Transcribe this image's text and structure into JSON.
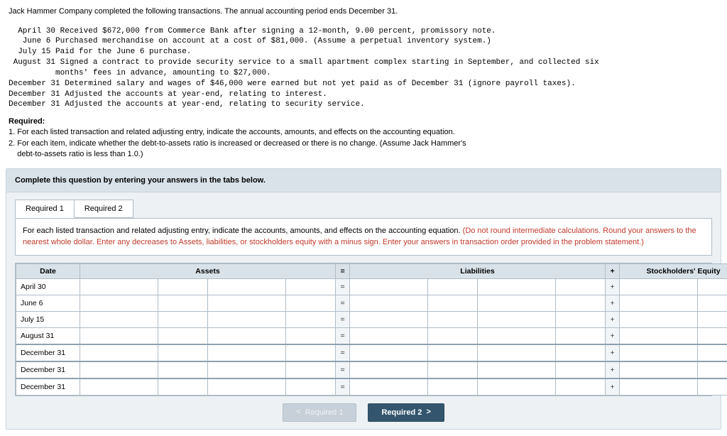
{
  "intro_line": "Jack Hammer Company completed the following transactions. The annual accounting period ends December 31.",
  "transactions_block": "  April 30 Received $672,000 from Commerce Bank after signing a 12-month, 9.00 percent, promissory note.\n   June 6 Purchased merchandise on account at a cost of $81,000. (Assume a perpetual inventory system.)\n  July 15 Paid for the June 6 purchase.\n August 31 Signed a contract to provide security service to a small apartment complex starting in September, and collected six\n          months' fees in advance, amounting to $27,000.\nDecember 31 Determined salary and wages of $46,000 were earned but not yet paid as of December 31 (ignore payroll taxes).\nDecember 31 Adjusted the accounts at year-end, relating to interest.\nDecember 31 Adjusted the accounts at year-end, relating to security service.",
  "required_label": "Required:",
  "required_items": {
    "r1": "1. For each listed transaction and related adjusting entry, indicate the accounts, amounts, and effects on the accounting equation.",
    "r2a": "2. For each item, indicate whether the debt-to-assets ratio is increased or decreased or there is no change. (Assume Jack Hammer's",
    "r2b": "    debt-to-assets ratio is less than 1.0.)"
  },
  "panel_intro": "Complete this question by entering your answers in the tabs below.",
  "tabs": {
    "t1": "Required 1",
    "t2": "Required 2"
  },
  "tab_instructions_black": "For each listed transaction and related adjusting entry, indicate the accounts, amounts, and effects on the accounting equation. ",
  "tab_instructions_red": "(Do not round intermediate calculations. Round your answers to the nearest whole dollar. Enter any decreases to Assets, liabilities, or stockholders equity with a minus sign. Enter your answers in transaction order provided in the problem statement.)",
  "headers": {
    "date": "Date",
    "assets": "Assets",
    "eq": "=",
    "liabilities": "Liabilities",
    "plus": "+",
    "equity": "Stockholders' Equity"
  },
  "rows": [
    {
      "date": "April 30"
    },
    {
      "date": "June 6"
    },
    {
      "date": "July 15"
    },
    {
      "date": "August 31"
    },
    {
      "date": "December 31",
      "thick": true
    },
    {
      "date": "December 31",
      "thick": true
    },
    {
      "date": "December 31",
      "thick": true
    }
  ],
  "nav": {
    "prev": "Required 1",
    "next": "Required 2"
  },
  "ops": {
    "eq": "=",
    "plus": "+"
  }
}
